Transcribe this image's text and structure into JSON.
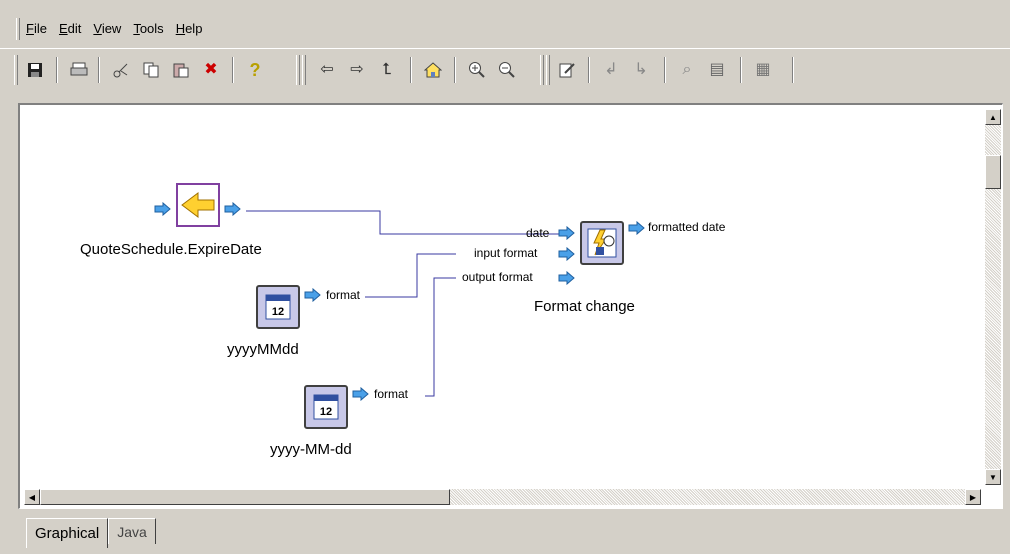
{
  "menu": {
    "items": [
      "File",
      "Edit",
      "View",
      "Tools",
      "Help"
    ]
  },
  "toolbar": {
    "buttons": [
      {
        "name": "save-icon",
        "glyph": "▪"
      },
      {
        "name": "print-icon",
        "glyph": "⎙"
      },
      {
        "name": "cut-icon",
        "glyph": "✂"
      },
      {
        "name": "copy-icon",
        "glyph": "⧉"
      },
      {
        "name": "paste-icon",
        "glyph": "📋"
      },
      {
        "name": "delete-icon",
        "glyph": "✖"
      },
      {
        "name": "help-icon",
        "glyph": "?"
      },
      {
        "name": "back-icon",
        "glyph": "⇦"
      },
      {
        "name": "forward-icon",
        "glyph": "⇨"
      },
      {
        "name": "up-icon",
        "glyph": "⇧"
      },
      {
        "name": "home-icon",
        "glyph": "⌂"
      },
      {
        "name": "zoom-in-icon",
        "glyph": "⊕"
      },
      {
        "name": "zoom-out-icon",
        "glyph": "⊖"
      },
      {
        "name": "edit-icon",
        "glyph": "✎"
      },
      {
        "name": "step-into-icon",
        "glyph": "↲"
      },
      {
        "name": "step-over-icon",
        "glyph": "↳"
      },
      {
        "name": "find-icon",
        "glyph": "⌕"
      },
      {
        "name": "document-icon",
        "glyph": "▤"
      },
      {
        "name": "tool-icon",
        "glyph": "▦"
      }
    ]
  },
  "diagram": {
    "source_node": {
      "label": "QuoteSchedule.ExpireDate"
    },
    "constant1": {
      "label": "yyyyMMdd",
      "port": "format"
    },
    "constant2": {
      "label": "yyyy-MM-dd",
      "port": "format"
    },
    "function_node": {
      "label": "Format change",
      "inputs": [
        "date",
        "input format",
        "output format"
      ],
      "output": "formatted date"
    }
  },
  "tabs": [
    {
      "label": "Graphical",
      "active": true
    },
    {
      "label": "Java",
      "active": false
    }
  ]
}
